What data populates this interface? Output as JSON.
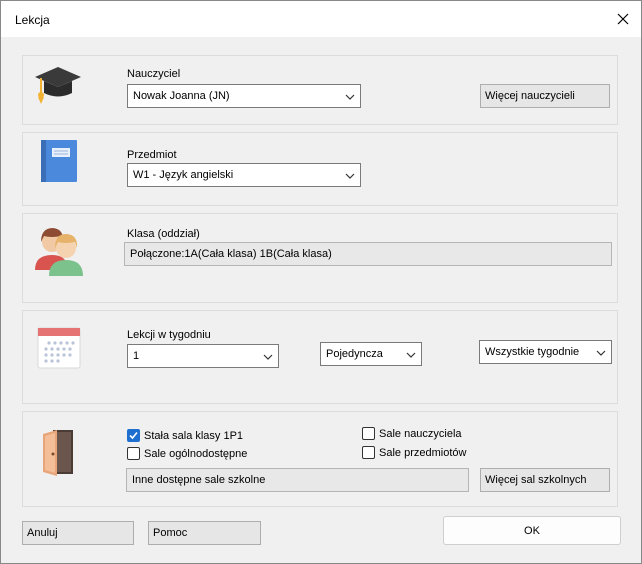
{
  "window": {
    "title": "Lekcja"
  },
  "teacher": {
    "label": "Nauczyciel",
    "selected": "Nowak Joanna (JN)",
    "more_button": "Więcej nauczycieli"
  },
  "subject": {
    "label": "Przedmiot",
    "selected": "W1 - Język angielski"
  },
  "class": {
    "label": "Klasa (oddział)",
    "value": "Połączone:1A(Cała klasa) 1B(Cała klasa)"
  },
  "lessons": {
    "label": "Lekcji w tygodniu",
    "count": "1",
    "type": "Pojedyncza",
    "weeks": "Wszystkie tygodnie"
  },
  "rooms": {
    "fixed_room_label": "Stała sala klasy 1P1",
    "fixed_room_checked": true,
    "public_rooms_label": "Sale ogólnodostępne",
    "public_rooms_checked": false,
    "teacher_rooms_label": "Sale nauczyciela",
    "teacher_rooms_checked": false,
    "subject_rooms_label": "Sale przedmiotów",
    "subject_rooms_checked": false,
    "other_rooms": "Inne dostępne sale szkolne",
    "more_rooms_button": "Więcej sal szkolnych"
  },
  "footer": {
    "cancel": "Anuluj",
    "help": "Pomoc",
    "ok": "OK"
  },
  "colors": {
    "accent": "#1e6fd0",
    "book": "#4a89dc",
    "door": "#e9a57a"
  }
}
